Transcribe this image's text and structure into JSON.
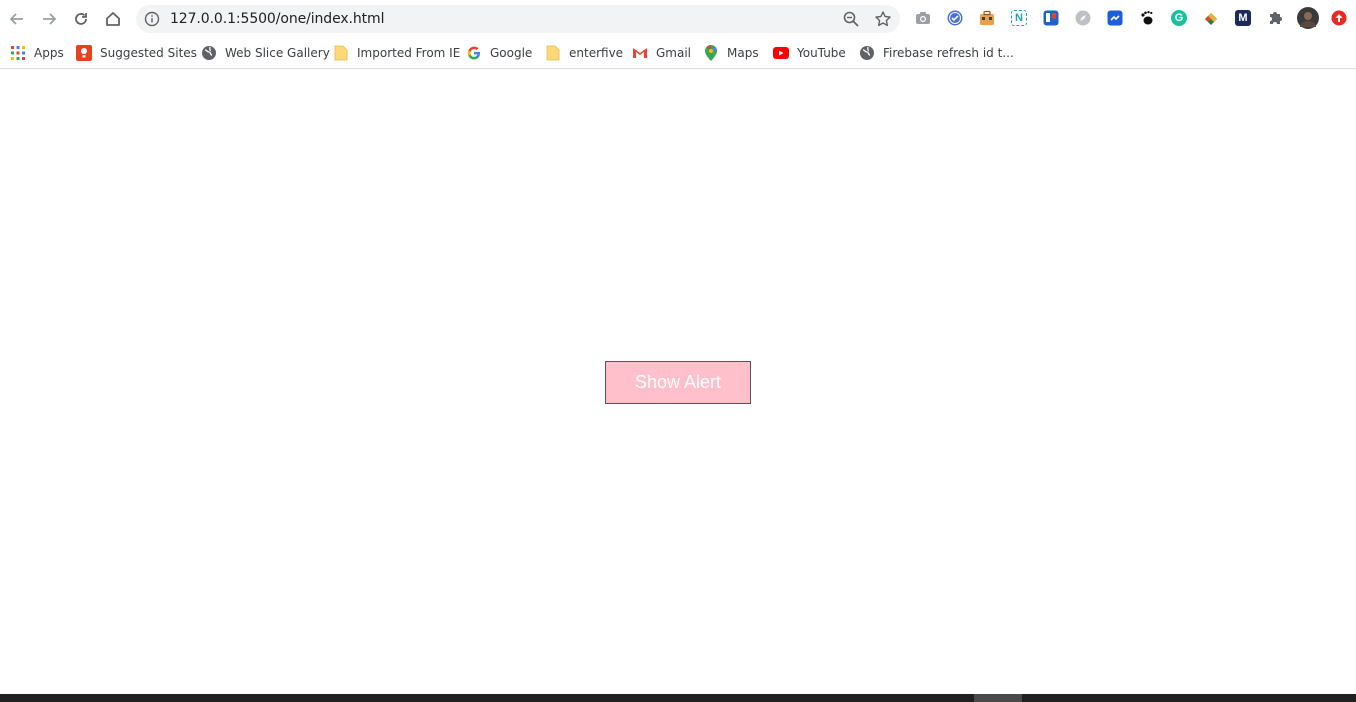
{
  "browser": {
    "url": "127.0.0.1:5500/one/index.html"
  },
  "bookmarks": [
    {
      "label": "Apps",
      "icon": "apps-grid-icon"
    },
    {
      "label": "Suggested Sites",
      "icon": "suggested-sites-icon"
    },
    {
      "label": "Web Slice Gallery",
      "icon": "globe-icon"
    },
    {
      "label": "Imported From IE",
      "icon": "folder-icon"
    },
    {
      "label": "Google",
      "icon": "google-icon"
    },
    {
      "label": "enterfive",
      "icon": "folder-icon"
    },
    {
      "label": "Gmail",
      "icon": "gmail-icon"
    },
    {
      "label": "Maps",
      "icon": "maps-icon"
    },
    {
      "label": "YouTube",
      "icon": "youtube-icon"
    },
    {
      "label": "Firebase refresh id t...",
      "icon": "globe-icon"
    }
  ],
  "extensions": {
    "n_label": "N",
    "m_label": "M",
    "g_label": "G"
  },
  "page": {
    "button_label": "Show Alert"
  },
  "colors": {
    "button_bg": "#ffc0cb",
    "button_text": "#ffffff",
    "omnibox_bg": "#f1f3f4"
  }
}
